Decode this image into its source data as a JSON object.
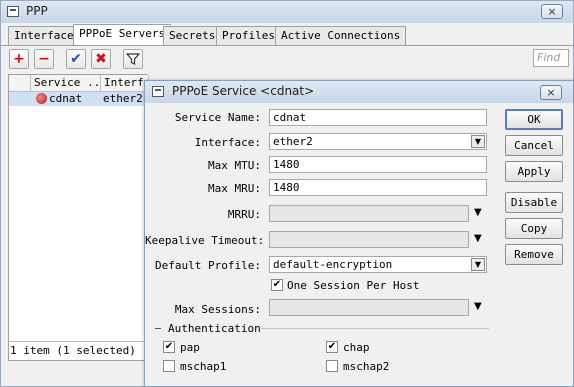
{
  "main_window": {
    "title": "PPP",
    "close_glyph": "×",
    "tabs": [
      {
        "label": "Interface",
        "active": false
      },
      {
        "label": "PPPoE Servers",
        "active": true
      },
      {
        "label": "Secrets",
        "active": false
      },
      {
        "label": "Profiles",
        "active": false
      },
      {
        "label": "Active Connections",
        "active": false
      }
    ],
    "toolbar": {
      "add_icon": "plus-icon",
      "remove_icon": "minus-icon",
      "enable_icon": "check-icon",
      "disable_icon": "x-icon",
      "filter_icon": "filter-icon"
    },
    "find_placeholder": "Find",
    "columns": [
      "Service ...",
      "Interfa"
    ],
    "rows": [
      {
        "service": "cdnat",
        "interface": "ether2",
        "selected": true
      }
    ],
    "status": "1 item (1 selected)"
  },
  "dialog": {
    "title": "PPPoE Service <cdnat>",
    "close_glyph": "×",
    "fields": {
      "service_name": {
        "label": "Service Name:",
        "value": "cdnat"
      },
      "interface": {
        "label": "Interface:",
        "value": "ether2"
      },
      "max_mtu": {
        "label": "Max MTU:",
        "value": "1480"
      },
      "max_mru": {
        "label": "Max MRU:",
        "value": "1480"
      },
      "mrru": {
        "label": "MRRU:",
        "value": ""
      },
      "keepalive_timeout": {
        "label": "Keepalive Timeout:",
        "value": ""
      },
      "default_profile": {
        "label": "Default Profile:",
        "value": "default-encryption"
      },
      "one_session": {
        "label": "One Session Per Host",
        "checked": true
      },
      "max_sessions": {
        "label": "Max Sessions:",
        "value": ""
      }
    },
    "authentication": {
      "legend": "Authentication",
      "pap": {
        "label": "pap",
        "checked": true
      },
      "chap": {
        "label": "chap",
        "checked": true
      },
      "mschap1": {
        "label": "mschap1",
        "checked": false
      },
      "mschap2": {
        "label": "mschap2",
        "checked": false
      }
    },
    "buttons": {
      "ok": "OK",
      "cancel": "Cancel",
      "apply": "Apply",
      "disable": "Disable",
      "copy": "Copy",
      "remove": "Remove"
    },
    "check_glyph": "✔",
    "dropdown_glyph": "▼"
  },
  "colors": {
    "title_gradient_top": "#dfe8f3",
    "title_gradient_bottom": "#c9d6e6",
    "selection": "#cfe0f5",
    "add_red": "#cc1111",
    "check_blue": "#1f4fa8"
  }
}
